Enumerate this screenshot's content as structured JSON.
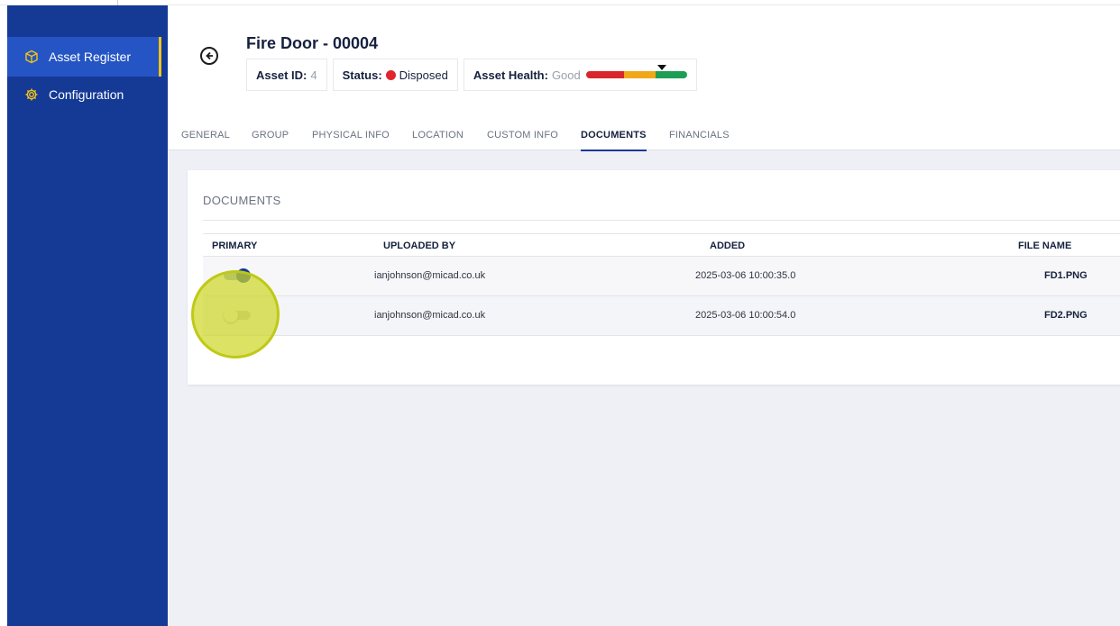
{
  "sidebar": {
    "items": [
      {
        "label": "Asset Register",
        "icon": "cube-icon",
        "active": true
      },
      {
        "label": "Configuration",
        "icon": "gear-icon",
        "active": false
      }
    ]
  },
  "asset": {
    "title": "Fire Door - 00004",
    "id_key": "Asset ID:",
    "id_value": "4",
    "status_key": "Status:",
    "status_value": "Disposed",
    "health_key": "Asset Health:",
    "health_value": "Good"
  },
  "tabs": [
    {
      "label": "GENERAL",
      "active": false
    },
    {
      "label": "GROUP",
      "active": false
    },
    {
      "label": "PHYSICAL INFO",
      "active": false
    },
    {
      "label": "LOCATION",
      "active": false
    },
    {
      "label": "CUSTOM INFO",
      "active": false
    },
    {
      "label": "DOCUMENTS",
      "active": true
    },
    {
      "label": "FINANCIALS",
      "active": false
    }
  ],
  "documents": {
    "title": "DOCUMENTS",
    "columns": {
      "primary": "PRIMARY",
      "uploaded_by": "UPLOADED BY",
      "added": "ADDED",
      "file_name": "FILE NAME"
    },
    "rows": [
      {
        "primary": true,
        "uploaded_by": "ianjohnson@micad.co.uk",
        "added": "2025-03-06 10:00:35.0",
        "file_name": "FD1.PNG"
      },
      {
        "primary": false,
        "uploaded_by": "ianjohnson@micad.co.uk",
        "added": "2025-03-06 10:00:54.0",
        "file_name": "FD2.PNG"
      }
    ]
  },
  "colors": {
    "sidebar_bg": "#153a96",
    "sidebar_active": "#2555c4",
    "active_indicator": "#f0c419",
    "status_disposed": "#e0262c",
    "health_red": "#d9262c",
    "health_orange": "#f0a818",
    "health_green": "#1e9e55",
    "highlight": "#cdd728"
  }
}
